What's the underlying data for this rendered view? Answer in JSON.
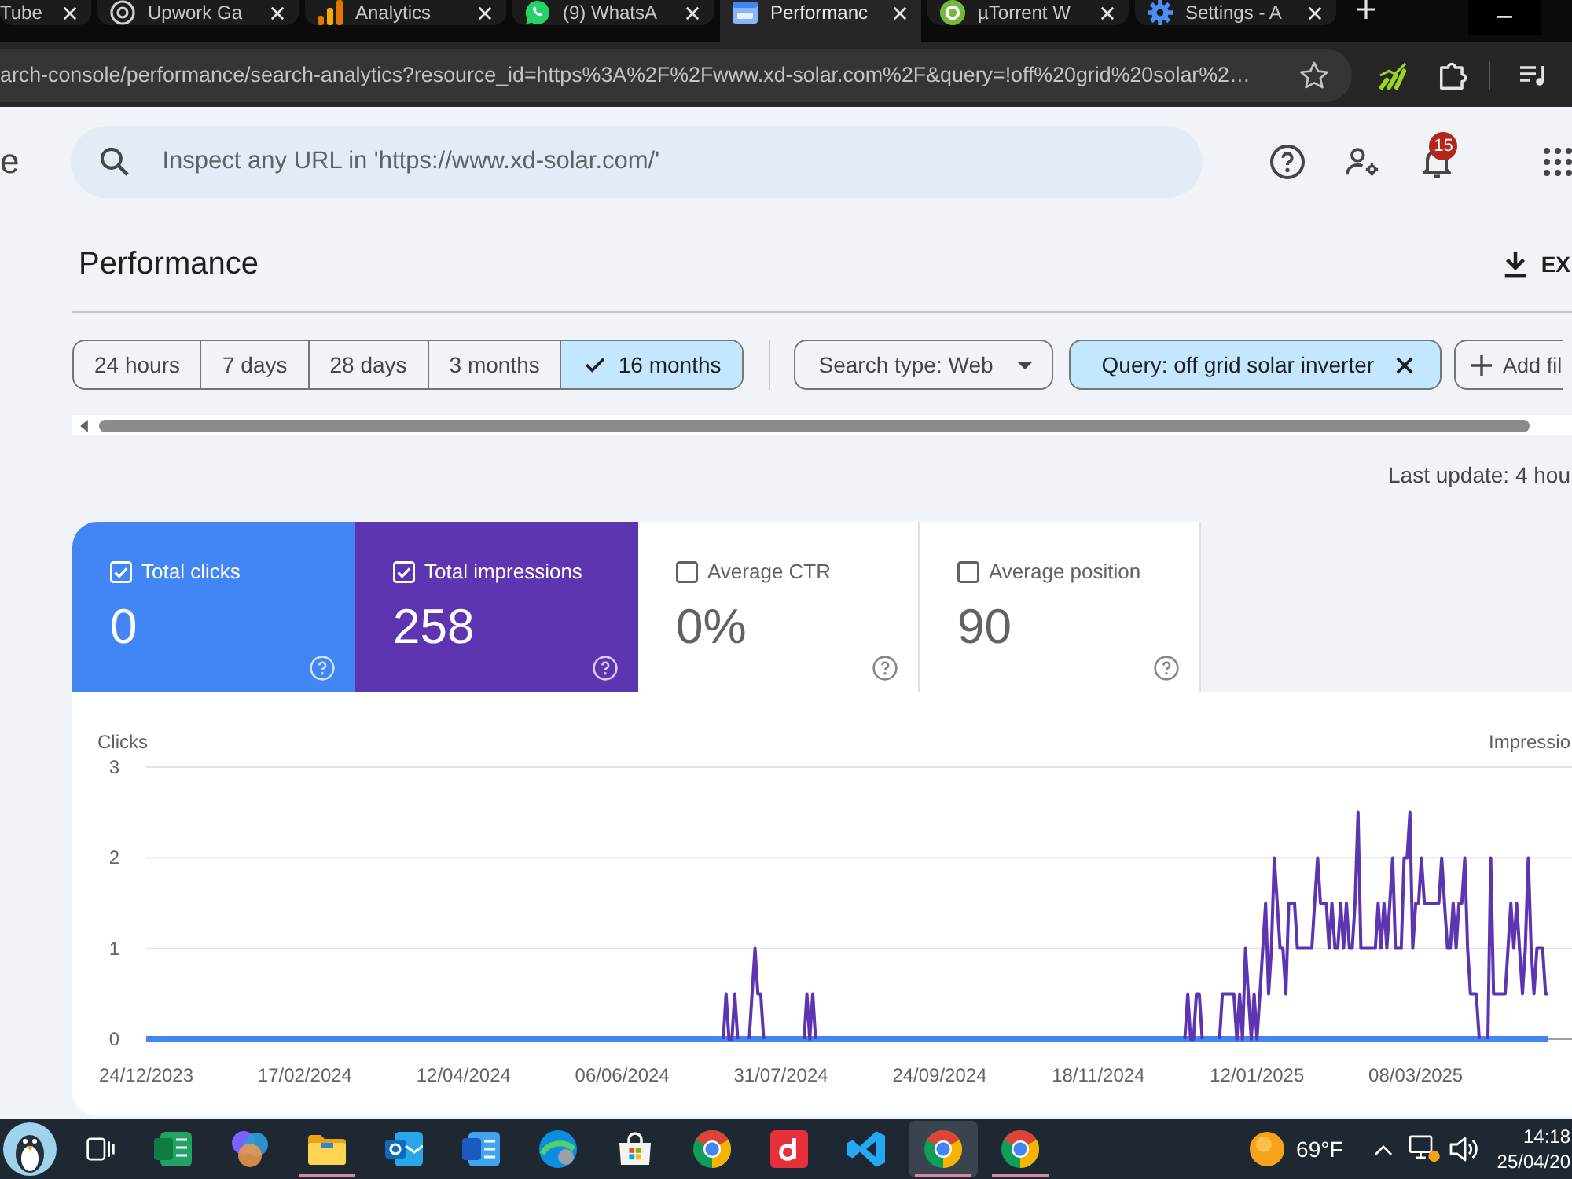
{
  "browser": {
    "tabs": [
      {
        "title": "Tube",
        "selected": false
      },
      {
        "title": "Upwork Ga",
        "selected": false
      },
      {
        "title": "Analytics",
        "selected": false
      },
      {
        "title": "(9) WhatsA",
        "selected": false
      },
      {
        "title": "Performanc",
        "selected": true
      },
      {
        "title": "µTorrent W",
        "selected": false
      },
      {
        "title": "Settings - A",
        "selected": false
      }
    ],
    "address_bar": {
      "url": "arch-console/performance/search-analytics?resource_id=https%3A%2F%2Fwww.xd-solar.com%2F&query=!off%20grid%20solar%2…"
    }
  },
  "header": {
    "logo_text": "e",
    "search": {
      "placeholder": "Inspect any URL in 'https://www.xd-solar.com/'"
    },
    "notifications": {
      "badge": "15"
    }
  },
  "page": {
    "title": "Performance",
    "export_button": "EX"
  },
  "date_ranges": [
    {
      "label": "24 hours",
      "selected": false
    },
    {
      "label": "7 days",
      "selected": false
    },
    {
      "label": "28 days",
      "selected": false
    },
    {
      "label": "3 months",
      "selected": false
    },
    {
      "label": "16 months",
      "selected": true
    }
  ],
  "filters": {
    "search_type": "Search type: Web",
    "query": "Query: off grid solar inverter",
    "add_filter": "Add fil"
  },
  "last_update": "Last update: 4 hou",
  "metrics": [
    {
      "label": "Total clicks",
      "value": "0",
      "checked": true,
      "color": "#4285f4"
    },
    {
      "label": "Total impressions",
      "value": "258",
      "checked": true,
      "color": "#5e35b1"
    },
    {
      "label": "Average CTR",
      "value": "0%",
      "checked": false
    },
    {
      "label": "Average position",
      "value": "90",
      "checked": false
    }
  ],
  "chart": {
    "right_axis_label": "Impressio",
    "chart_data": {
      "type": "line",
      "ylabel": "Clicks",
      "ylim": [
        0,
        3
      ],
      "yticks": [
        0,
        1,
        2,
        3
      ],
      "categories": [
        "24/12/2023",
        null,
        null,
        null,
        null,
        null,
        null,
        null,
        null,
        null,
        null,
        null,
        null,
        null,
        null,
        null,
        null,
        null,
        null,
        null,
        null,
        null,
        null,
        null,
        null,
        null,
        null,
        null,
        null,
        null,
        null,
        null,
        null,
        null,
        null,
        null,
        null,
        null,
        null,
        null,
        null,
        null,
        null,
        null,
        null,
        null,
        null,
        null,
        null,
        null,
        null,
        null,
        null,
        null,
        null,
        "17/02/2024",
        null,
        null,
        null,
        null,
        null,
        null,
        null,
        null,
        null,
        null,
        null,
        null,
        null,
        null,
        null,
        null,
        null,
        null,
        null,
        null,
        null,
        null,
        null,
        null,
        null,
        null,
        null,
        null,
        null,
        null,
        null,
        null,
        null,
        null,
        null,
        null,
        null,
        null,
        null,
        null,
        null,
        null,
        null,
        null,
        null,
        null,
        null,
        null,
        null,
        null,
        null,
        null,
        null,
        null,
        "12/04/2024",
        null,
        null,
        null,
        null,
        null,
        null,
        null,
        null,
        null,
        null,
        null,
        null,
        null,
        null,
        null,
        null,
        null,
        null,
        null,
        null,
        null,
        null,
        null,
        null,
        null,
        null,
        null,
        null,
        null,
        null,
        null,
        null,
        null,
        null,
        null,
        null,
        null,
        null,
        null,
        null,
        null,
        null,
        null,
        null,
        null,
        null,
        null,
        null,
        null,
        null,
        null,
        null,
        null,
        null,
        "06/06/2024",
        null,
        null,
        null,
        null,
        null,
        null,
        null,
        null,
        null,
        null,
        null,
        null,
        null,
        null,
        null,
        null,
        null,
        null,
        null,
        null,
        null,
        null,
        null,
        null,
        null,
        null,
        null,
        null,
        null,
        null,
        null,
        null,
        null,
        null,
        null,
        null,
        null,
        null,
        null,
        null,
        null,
        null,
        null,
        null,
        null,
        null,
        null,
        null,
        null,
        null,
        null,
        null,
        null,
        null,
        "31/07/2024",
        null,
        null,
        null,
        null,
        null,
        null,
        null,
        null,
        null,
        null,
        null,
        null,
        null,
        null,
        null,
        null,
        null,
        null,
        null,
        null,
        null,
        null,
        null,
        null,
        null,
        null,
        null,
        null,
        null,
        null,
        null,
        null,
        null,
        null,
        null,
        null,
        null,
        null,
        null,
        null,
        null,
        null,
        null,
        null,
        null,
        null,
        null,
        null,
        null,
        null,
        null,
        null,
        null,
        null,
        "24/09/2024",
        null,
        null,
        null,
        null,
        null,
        null,
        null,
        null,
        null,
        null,
        null,
        null,
        null,
        null,
        null,
        null,
        null,
        null,
        null,
        null,
        null,
        null,
        null,
        null,
        null,
        null,
        null,
        null,
        null,
        null,
        null,
        null,
        null,
        null,
        null,
        null,
        null,
        null,
        null,
        null,
        null,
        null,
        null,
        null,
        null,
        null,
        null,
        null,
        null,
        null,
        null,
        null,
        null,
        null,
        "18/11/2024",
        null,
        null,
        null,
        null,
        null,
        null,
        null,
        null,
        null,
        null,
        null,
        null,
        null,
        null,
        null,
        null,
        null,
        null,
        null,
        null,
        null,
        null,
        null,
        null,
        null,
        null,
        null,
        null,
        null,
        null,
        null,
        null,
        null,
        null,
        null,
        null,
        null,
        null,
        null,
        null,
        null,
        null,
        null,
        null,
        null,
        null,
        null,
        null,
        null,
        null,
        null,
        null,
        null,
        null,
        "12/01/2025",
        null,
        null,
        null,
        null,
        null,
        null,
        null,
        null,
        null,
        null,
        null,
        null,
        null,
        null,
        null,
        null,
        null,
        null,
        null,
        null,
        null,
        null,
        null,
        null,
        null,
        null,
        null,
        null,
        null,
        null,
        null,
        null,
        null,
        null,
        null,
        null,
        null,
        null,
        null,
        null,
        null,
        null,
        null,
        null,
        null,
        null,
        null,
        null,
        null,
        null,
        null,
        null,
        null,
        null,
        "08/03/2025",
        null,
        null,
        null,
        null,
        null,
        null,
        null,
        null,
        null,
        null,
        null,
        null,
        null,
        null,
        null,
        null,
        null,
        null,
        null,
        null,
        null,
        null,
        null,
        null,
        null,
        null,
        null,
        null,
        null,
        null,
        null,
        null,
        null,
        null,
        null,
        null,
        null,
        null,
        null,
        null,
        null,
        null,
        null,
        null,
        null,
        null
      ],
      "series": [
        {
          "color": "#4285f4",
          "values": [
            0,
            0,
            0,
            0,
            0,
            0,
            0,
            0,
            0,
            0,
            0,
            0,
            0,
            0,
            0,
            0,
            0,
            0,
            0,
            0,
            0,
            0,
            0,
            0,
            0,
            0,
            0,
            0,
            0,
            0,
            0,
            0,
            0,
            0,
            0,
            0,
            0,
            0,
            0,
            0,
            0,
            0,
            0,
            0,
            0,
            0,
            0,
            0,
            0,
            0,
            0,
            0,
            0,
            0,
            0,
            0,
            0,
            0,
            0,
            0,
            0,
            0,
            0,
            0,
            0,
            0,
            0,
            0,
            0,
            0,
            0,
            0,
            0,
            0,
            0,
            0,
            0,
            0,
            0,
            0,
            0,
            0,
            0,
            0,
            0,
            0,
            0,
            0,
            0,
            0,
            0,
            0,
            0,
            0,
            0,
            0,
            0,
            0,
            0,
            0,
            0,
            0,
            0,
            0,
            0,
            0,
            0,
            0,
            0,
            0,
            0,
            0,
            0,
            0,
            0,
            0,
            0,
            0,
            0,
            0,
            0,
            0,
            0,
            0,
            0,
            0,
            0,
            0,
            0,
            0,
            0,
            0,
            0,
            0,
            0,
            0,
            0,
            0,
            0,
            0,
            0,
            0,
            0,
            0,
            0,
            0,
            0,
            0,
            0,
            0,
            0,
            0,
            0,
            0,
            0,
            0,
            0,
            0,
            0,
            0,
            0,
            0,
            0,
            0,
            0,
            0,
            0,
            0,
            0,
            0,
            0,
            0,
            0,
            0,
            0,
            0,
            0,
            0,
            0,
            0,
            0,
            0,
            0,
            0,
            0,
            0,
            0,
            0,
            0,
            0,
            0,
            0,
            0,
            0,
            0,
            0,
            0,
            0,
            0,
            0,
            0,
            0,
            0,
            0,
            0,
            0,
            0,
            0,
            0,
            0,
            0,
            0,
            0,
            0,
            0,
            0,
            0,
            0,
            0,
            0,
            0,
            0,
            0,
            0,
            0,
            0,
            0,
            0,
            0,
            0,
            0,
            0,
            0,
            0,
            0,
            0,
            0,
            0,
            0,
            0,
            0,
            0,
            0,
            0,
            0,
            0,
            0,
            0,
            0,
            0,
            0,
            0,
            0,
            0,
            0,
            0,
            0,
            0,
            0,
            0,
            0,
            0,
            0,
            0,
            0,
            0,
            0,
            0,
            0,
            0,
            0,
            0,
            0,
            0,
            0,
            0,
            0,
            0,
            0,
            0,
            0,
            0,
            0,
            0,
            0,
            0,
            0,
            0,
            0,
            0,
            0,
            0,
            0,
            0,
            0,
            0,
            0,
            0,
            0,
            0,
            0,
            0,
            0,
            0,
            0,
            0,
            0,
            0,
            0,
            0,
            0,
            0,
            0,
            0,
            0,
            0,
            0,
            0,
            0,
            0,
            0,
            0,
            0,
            0,
            0,
            0,
            0,
            0,
            0,
            0,
            0,
            0,
            0,
            0,
            0,
            0,
            0,
            0,
            0,
            0,
            0,
            0,
            0,
            0,
            0,
            0,
            0,
            0,
            0,
            0,
            0,
            0,
            0,
            0,
            0,
            0,
            0,
            0,
            0,
            0,
            0,
            0,
            0,
            0,
            0,
            0,
            0,
            0,
            0,
            0,
            0,
            0,
            0,
            0,
            0,
            0,
            0,
            0,
            0,
            0,
            0,
            0,
            0,
            0,
            0,
            0,
            0,
            0,
            0,
            0,
            0,
            0,
            0,
            0,
            0,
            0,
            0,
            0,
            0,
            0,
            0,
            0,
            0,
            0,
            0,
            0,
            0,
            0,
            0,
            0,
            0,
            0,
            0,
            0,
            0,
            0,
            0,
            0,
            0,
            0,
            0,
            0,
            0,
            0,
            0,
            0,
            0,
            0,
            0,
            0,
            0,
            0,
            0,
            0,
            0,
            0,
            0,
            0,
            0,
            0,
            0,
            0,
            0,
            0,
            0,
            0,
            0,
            0,
            0,
            0,
            0,
            0,
            0,
            0,
            0,
            0,
            0,
            0,
            0,
            0,
            0,
            0,
            0,
            0,
            0,
            0,
            0,
            0,
            0,
            0,
            0,
            0,
            0,
            0,
            0,
            0,
            0,
            0,
            0,
            0,
            0,
            0,
            0,
            0,
            0,
            0,
            0
          ]
        },
        {
          "color": "#5e35b1",
          "values": [
            null,
            null,
            null,
            null,
            null,
            null,
            null,
            null,
            null,
            null,
            null,
            null,
            null,
            null,
            null,
            null,
            null,
            null,
            null,
            null,
            null,
            null,
            null,
            null,
            null,
            null,
            null,
            null,
            null,
            null,
            null,
            null,
            null,
            null,
            null,
            null,
            null,
            null,
            null,
            null,
            null,
            null,
            null,
            null,
            null,
            null,
            null,
            null,
            null,
            null,
            null,
            null,
            null,
            null,
            null,
            null,
            null,
            null,
            null,
            null,
            null,
            null,
            null,
            null,
            null,
            null,
            null,
            null,
            null,
            null,
            null,
            null,
            null,
            null,
            null,
            null,
            null,
            null,
            null,
            null,
            null,
            null,
            null,
            null,
            null,
            null,
            null,
            null,
            null,
            null,
            null,
            null,
            null,
            null,
            null,
            null,
            null,
            null,
            null,
            null,
            null,
            null,
            null,
            null,
            null,
            null,
            null,
            null,
            null,
            null,
            null,
            null,
            null,
            null,
            null,
            null,
            null,
            null,
            null,
            null,
            null,
            null,
            null,
            null,
            null,
            null,
            null,
            null,
            null,
            null,
            null,
            null,
            null,
            null,
            null,
            null,
            null,
            null,
            null,
            null,
            null,
            null,
            null,
            null,
            null,
            null,
            null,
            null,
            null,
            null,
            null,
            null,
            null,
            null,
            null,
            null,
            null,
            null,
            null,
            null,
            null,
            null,
            null,
            null,
            null,
            null,
            null,
            null,
            null,
            null,
            null,
            null,
            null,
            null,
            null,
            null,
            null,
            null,
            null,
            null,
            null,
            null,
            null,
            null,
            null,
            null,
            null,
            null,
            null,
            null,
            null,
            null,
            null,
            null,
            null,
            null,
            null,
            null,
            null,
            null,
            0,
            0.5,
            0,
            0,
            0.5,
            0,
            null,
            null,
            null,
            0,
            0.5,
            1,
            0.5,
            0.5,
            0,
            null,
            null,
            null,
            null,
            null,
            null,
            null,
            null,
            null,
            null,
            null,
            null,
            null,
            0,
            0.5,
            0,
            0.5,
            0,
            null,
            null,
            null,
            null,
            null,
            null,
            null,
            null,
            null,
            null,
            null,
            null,
            null,
            null,
            null,
            null,
            null,
            null,
            null,
            null,
            null,
            null,
            null,
            null,
            null,
            null,
            null,
            null,
            null,
            null,
            null,
            null,
            null,
            null,
            null,
            null,
            null,
            null,
            null,
            null,
            null,
            null,
            null,
            null,
            null,
            null,
            null,
            null,
            null,
            null,
            null,
            null,
            null,
            null,
            null,
            null,
            null,
            null,
            null,
            null,
            null,
            null,
            null,
            null,
            null,
            null,
            null,
            null,
            null,
            null,
            null,
            null,
            null,
            null,
            null,
            null,
            null,
            null,
            null,
            null,
            null,
            null,
            null,
            null,
            null,
            null,
            null,
            null,
            null,
            null,
            null,
            null,
            null,
            null,
            null,
            null,
            null,
            null,
            null,
            null,
            null,
            null,
            null,
            null,
            null,
            null,
            null,
            null,
            null,
            null,
            null,
            null,
            null,
            null,
            null,
            null,
            null,
            null,
            null,
            null,
            null,
            null,
            null,
            null,
            null,
            null,
            null,
            0,
            0.5,
            0,
            0,
            0.5,
            0.5,
            0,
            null,
            null,
            null,
            null,
            null,
            0,
            0.5,
            0.5,
            0.5,
            0.5,
            0.5,
            0,
            0.5,
            0,
            1,
            0.5,
            0,
            0.5,
            0,
            0.5,
            1,
            1.5,
            0.5,
            1,
            2,
            1.5,
            1,
            1,
            0.5,
            1.5,
            1.5,
            1.5,
            1,
            1,
            1,
            1,
            1,
            1,
            1.5,
            2,
            1.5,
            1.5,
            1.5,
            1,
            1.5,
            1,
            1,
            1.5,
            1,
            1.5,
            1,
            1,
            1.5,
            2.5,
            1,
            1,
            1,
            1,
            1,
            1,
            1.5,
            1,
            1.5,
            1,
            1.5,
            2,
            1,
            1,
            1,
            2,
            2,
            2.5,
            1,
            1.5,
            1.5,
            2,
            1.5,
            1.5,
            1.5,
            1.5,
            1.5,
            1.5,
            2,
            1.5,
            1,
            1,
            1.5,
            1,
            1.5,
            1.5,
            2,
            1,
            0.5,
            0.5,
            0.5,
            0,
            null,
            null,
            0,
            2,
            0.5,
            0.5,
            0.5,
            0.5,
            0.5,
            1,
            1.5,
            1,
            1.5,
            1,
            0.5,
            1,
            2,
            1,
            0.5,
            1,
            1,
            1,
            0.5,
            0.5
          ]
        }
      ]
    }
  },
  "taskbar": {
    "apps": [
      {
        "selected": false,
        "running": false
      },
      {
        "selected": false,
        "running": false
      },
      {
        "selected": false,
        "running": true
      },
      {
        "selected": false,
        "running": false
      },
      {
        "selected": false,
        "running": false
      },
      {
        "selected": false,
        "running": false
      },
      {
        "selected": false,
        "running": false
      },
      {
        "selected": false,
        "running": false
      },
      {
        "selected": false,
        "running": false
      },
      {
        "selected": false,
        "running": false
      },
      {
        "selected": true,
        "running": true
      },
      {
        "selected": false,
        "running": true
      }
    ],
    "weather": {
      "temperature": "69°F"
    },
    "clock": {
      "time": "14:18",
      "date": "25/04/20"
    }
  }
}
